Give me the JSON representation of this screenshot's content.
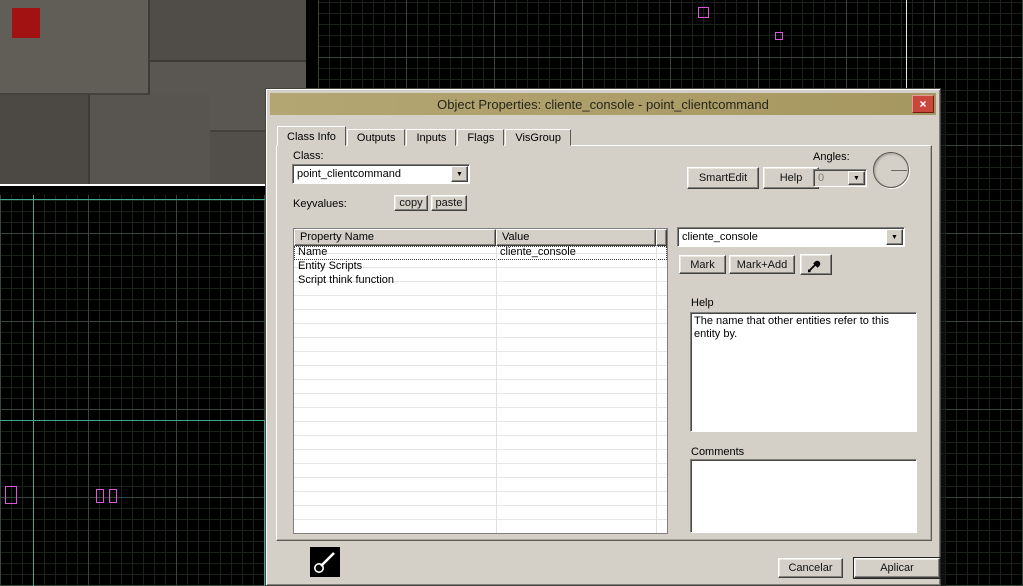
{
  "window": {
    "title": "Object Properties: cliente_console - point_clientcommand"
  },
  "icons": {
    "close": "×",
    "dropdown": "▼"
  },
  "tabs": [
    {
      "label": "Class Info"
    },
    {
      "label": "Outputs"
    },
    {
      "label": "Inputs"
    },
    {
      "label": "Flags"
    },
    {
      "label": "VisGroup"
    }
  ],
  "class_section": {
    "label": "Class:",
    "value": "point_clientcommand",
    "smartedit_label": "SmartEdit",
    "help_label": "Help",
    "angles_label": "Angles:",
    "angles_value": "0"
  },
  "keyvalues": {
    "label": "Keyvalues:",
    "copy_label": "copy",
    "paste_label": "paste",
    "columns": [
      "Property Name",
      "Value"
    ],
    "rows": [
      {
        "name": "Name",
        "value": "cliente_console"
      },
      {
        "name": "Entity Scripts",
        "value": ""
      },
      {
        "name": "Script think function",
        "value": ""
      }
    ]
  },
  "entity_panel": {
    "target_value": "cliente_console",
    "mark_label": "Mark",
    "mark_add_label": "Mark+Add",
    "help_label": "Help",
    "help_text": "The name that other entities refer to this entity by.",
    "comments_label": "Comments",
    "comments_value": ""
  },
  "footer": {
    "cancel_label": "Cancelar",
    "apply_label": "Aplicar"
  },
  "colors": {
    "titlebar": "#ae9f6a",
    "dialog_bg": "#d4d0c8",
    "close_button": "#c8463b",
    "grid_minor": "#1a2119",
    "grid_major": "#38453c",
    "selection_magenta": "#d958d9",
    "wire_cyan": "#3fa98f",
    "brush_red": "#a31212"
  }
}
